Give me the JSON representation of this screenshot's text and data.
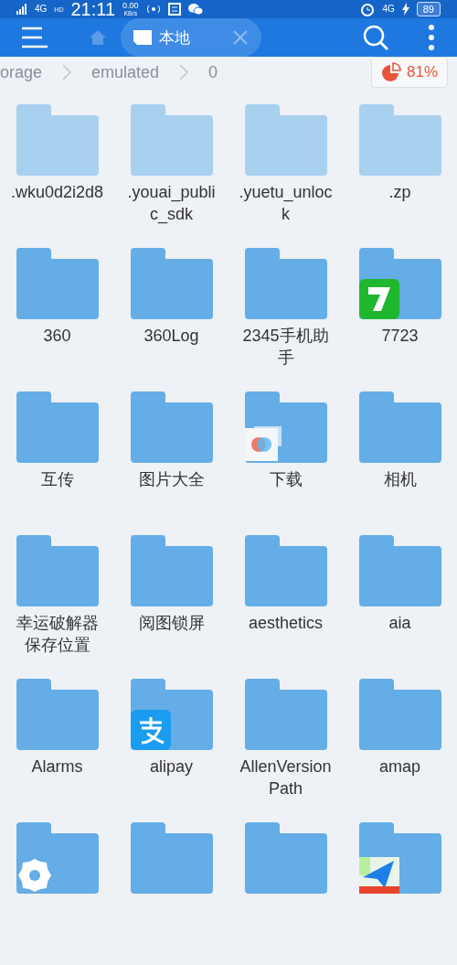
{
  "status_bar": {
    "network": "4G",
    "network_sub": "HD",
    "time": "21:11",
    "speed": "0.00",
    "speed_unit": "KB/s",
    "right_network": "4G",
    "battery": "89"
  },
  "toolbar": {
    "tab": {
      "label": "本地",
      "selected": true
    }
  },
  "breadcrumb": {
    "items": [
      "orage",
      "emulated",
      "0"
    ],
    "usage": "81%"
  },
  "folders": [
    {
      "name": ".wku0d2i2d8",
      "hidden": true,
      "kind": "plain"
    },
    {
      "name": ".youai_public_sdk",
      "hidden": true,
      "kind": "plain"
    },
    {
      "name": ".yuetu_unlock",
      "hidden": true,
      "kind": "plain"
    },
    {
      "name": ".zp",
      "hidden": true,
      "kind": "plain"
    },
    {
      "name": "360",
      "hidden": false,
      "kind": "plain"
    },
    {
      "name": "360Log",
      "hidden": false,
      "kind": "plain"
    },
    {
      "name": "2345手机助手",
      "hidden": false,
      "kind": "plain"
    },
    {
      "name": "7723",
      "hidden": false,
      "kind": "seven"
    },
    {
      "name": "互传",
      "hidden": false,
      "kind": "plain"
    },
    {
      "name": "图片大全",
      "hidden": false,
      "kind": "plain"
    },
    {
      "name": "下载",
      "hidden": false,
      "kind": "blossom"
    },
    {
      "name": "相机",
      "hidden": false,
      "kind": "plain"
    },
    {
      "name": "幸运破解器保存位置",
      "hidden": false,
      "kind": "plain"
    },
    {
      "name": "阅图锁屏",
      "hidden": false,
      "kind": "plain"
    },
    {
      "name": "aesthetics",
      "hidden": false,
      "kind": "plain"
    },
    {
      "name": "aia",
      "hidden": false,
      "kind": "plain"
    },
    {
      "name": "Alarms",
      "hidden": false,
      "kind": "plain"
    },
    {
      "name": "alipay",
      "hidden": false,
      "kind": "alipay"
    },
    {
      "name": "AllenVersionPath",
      "hidden": false,
      "kind": "plain"
    },
    {
      "name": "amap",
      "hidden": false,
      "kind": "plain"
    },
    {
      "hidden": false,
      "kind": "gear"
    },
    {
      "hidden": false,
      "kind": "plain"
    },
    {
      "hidden": false,
      "kind": "plain"
    },
    {
      "hidden": false,
      "kind": "plane"
    }
  ]
}
